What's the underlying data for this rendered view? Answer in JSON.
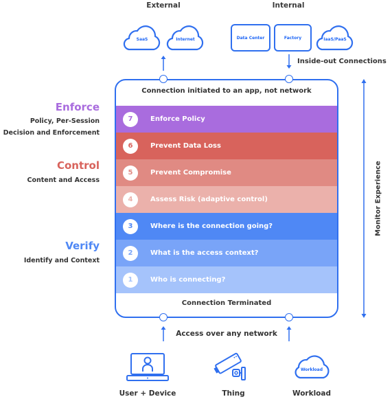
{
  "top": {
    "external_label": "External",
    "internal_label": "Internal",
    "external_items": [
      "SaaS",
      "Internet"
    ],
    "internal_boxes": [
      "Data Center",
      "Factory"
    ],
    "internal_cloud": "IaaS/PaaS",
    "inside_out_label": "Inside-out Connections"
  },
  "box": {
    "top_text": "Connection initiated to an app, not network",
    "bottom_text": "Connection Terminated"
  },
  "layers": [
    {
      "num": "7",
      "label": "Enforce Policy",
      "color": "#a96cde"
    },
    {
      "num": "6",
      "label": "Prevent Data Loss",
      "color": "#d8635c"
    },
    {
      "num": "5",
      "label": "Prevent Compromise",
      "color": "#e08a83"
    },
    {
      "num": "4",
      "label": "Assess Risk (adaptive control)",
      "color": "#ebb1ab"
    },
    {
      "num": "3",
      "label": "Where is the connection going?",
      "color": "#4f88f5"
    },
    {
      "num": "2",
      "label": "What is the access context?",
      "color": "#79a4f8"
    },
    {
      "num": "1",
      "label": "Who is connecting?",
      "color": "#a5c3fb"
    }
  ],
  "side": {
    "enforce": {
      "title": "Enforce",
      "sub": [
        "Policy, Per-Session",
        "Decision and Enforcement"
      ],
      "color": "#a96cde"
    },
    "control": {
      "title": "Control",
      "sub": [
        "Content and Access"
      ],
      "color": "#d8635c"
    },
    "verify": {
      "title": "Verify",
      "sub": [
        "Identify and Context"
      ],
      "color": "#4f88f5"
    }
  },
  "monitor_label": "Monitor Experience",
  "bottom": {
    "access_label": "Access over any network",
    "sources": [
      "User + Device",
      "Thing",
      "Workload"
    ],
    "workload_cloud": "Workload"
  },
  "colors": {
    "accent": "#2f6fef"
  }
}
